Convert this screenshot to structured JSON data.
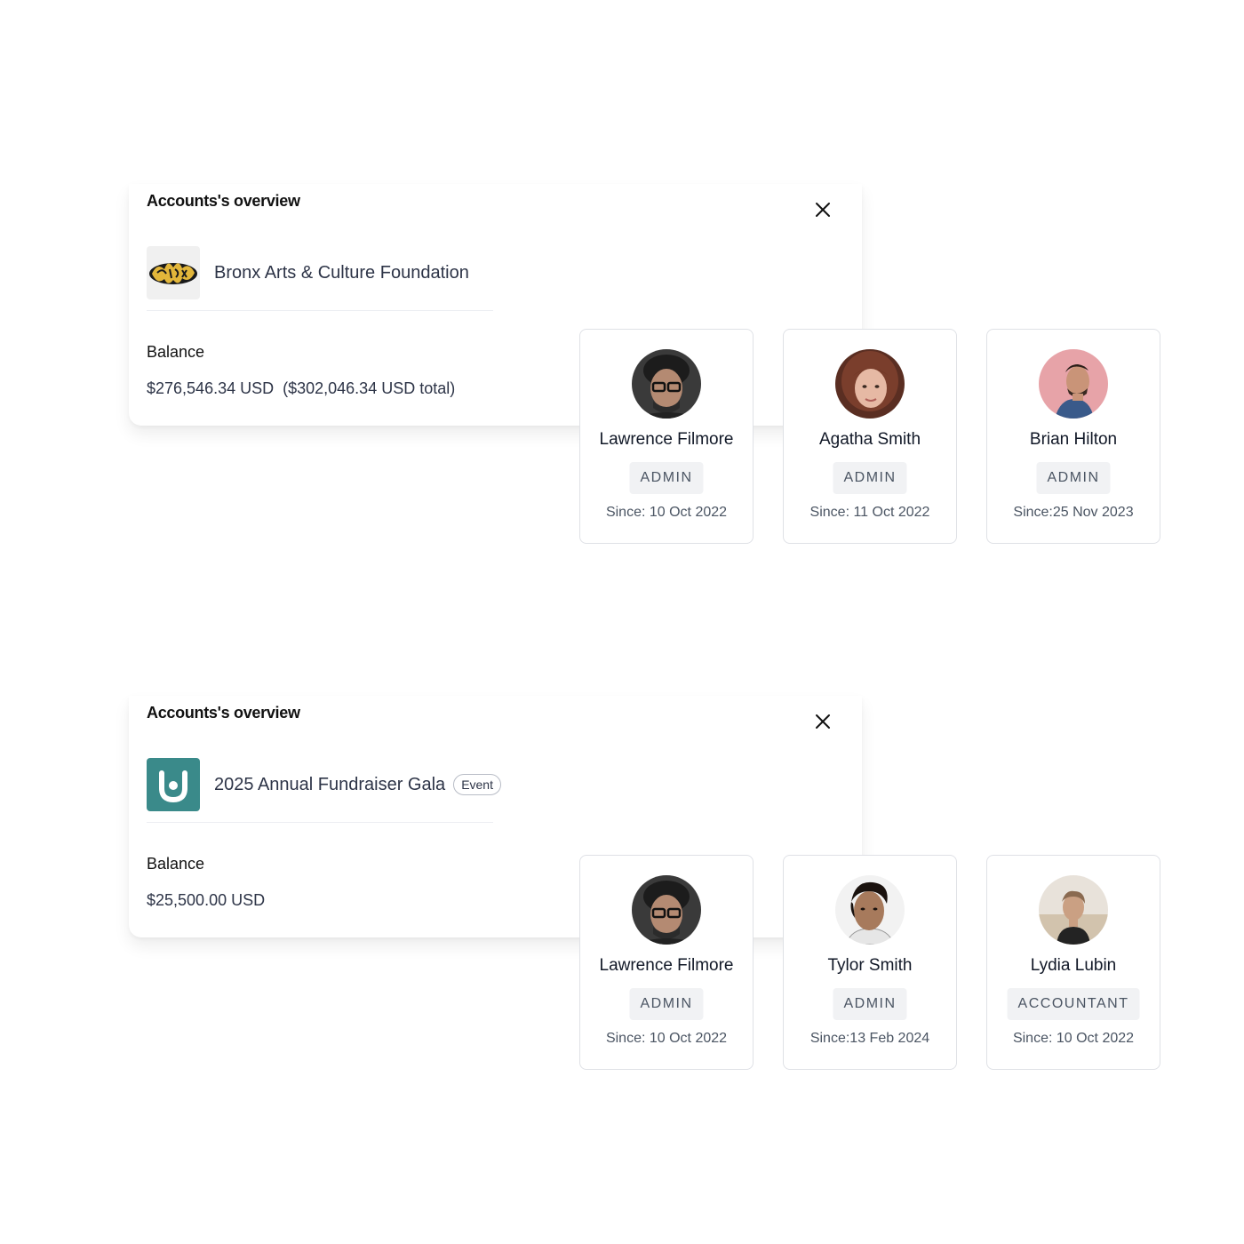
{
  "accounts": [
    {
      "panel_title": "Accounts's overview",
      "account_name": "Bronx Arts & Culture Foundation",
      "badge": "",
      "balance_label": "Balance",
      "balance_value": "$276,546.34 USD  ($302,046.34 USD total)",
      "logo_icon": "bronx-graffiti-logo",
      "members": [
        {
          "name": "Lawrence Filmore",
          "role": "ADMIN",
          "since": "Since: 10 Oct 2022",
          "avatar_icon": "avatar-lawrence"
        },
        {
          "name": "Agatha Smith",
          "role": "ADMIN",
          "since": "Since: 11 Oct 2022",
          "avatar_icon": "avatar-agatha"
        },
        {
          "name": "Brian Hilton",
          "role": "ADMIN",
          "since": "Since:25 Nov 2023",
          "avatar_icon": "avatar-brian"
        }
      ]
    },
    {
      "panel_title": "Accounts's overview",
      "account_name": "2025 Annual Fundraiser Gala",
      "badge": "Event",
      "balance_label": "Balance",
      "balance_value": "$25,500.00 USD",
      "logo_icon": "gala-teal-logo",
      "members": [
        {
          "name": "Lawrence Filmore",
          "role": "ADMIN",
          "since": "Since: 10 Oct 2022",
          "avatar_icon": "avatar-lawrence"
        },
        {
          "name": "Tylor Smith",
          "role": "ADMIN",
          "since": "Since:13 Feb 2024",
          "avatar_icon": "avatar-tylor"
        },
        {
          "name": "Lydia Lubin",
          "role": "ACCOUNTANT",
          "since": "Since: 10 Oct 2022",
          "avatar_icon": "avatar-lydia"
        }
      ]
    }
  ],
  "colors": {
    "gala_logo_bg": "#3a8a8a",
    "badge_bg": "#f1f2f4",
    "card_border": "#dfe1e6"
  }
}
